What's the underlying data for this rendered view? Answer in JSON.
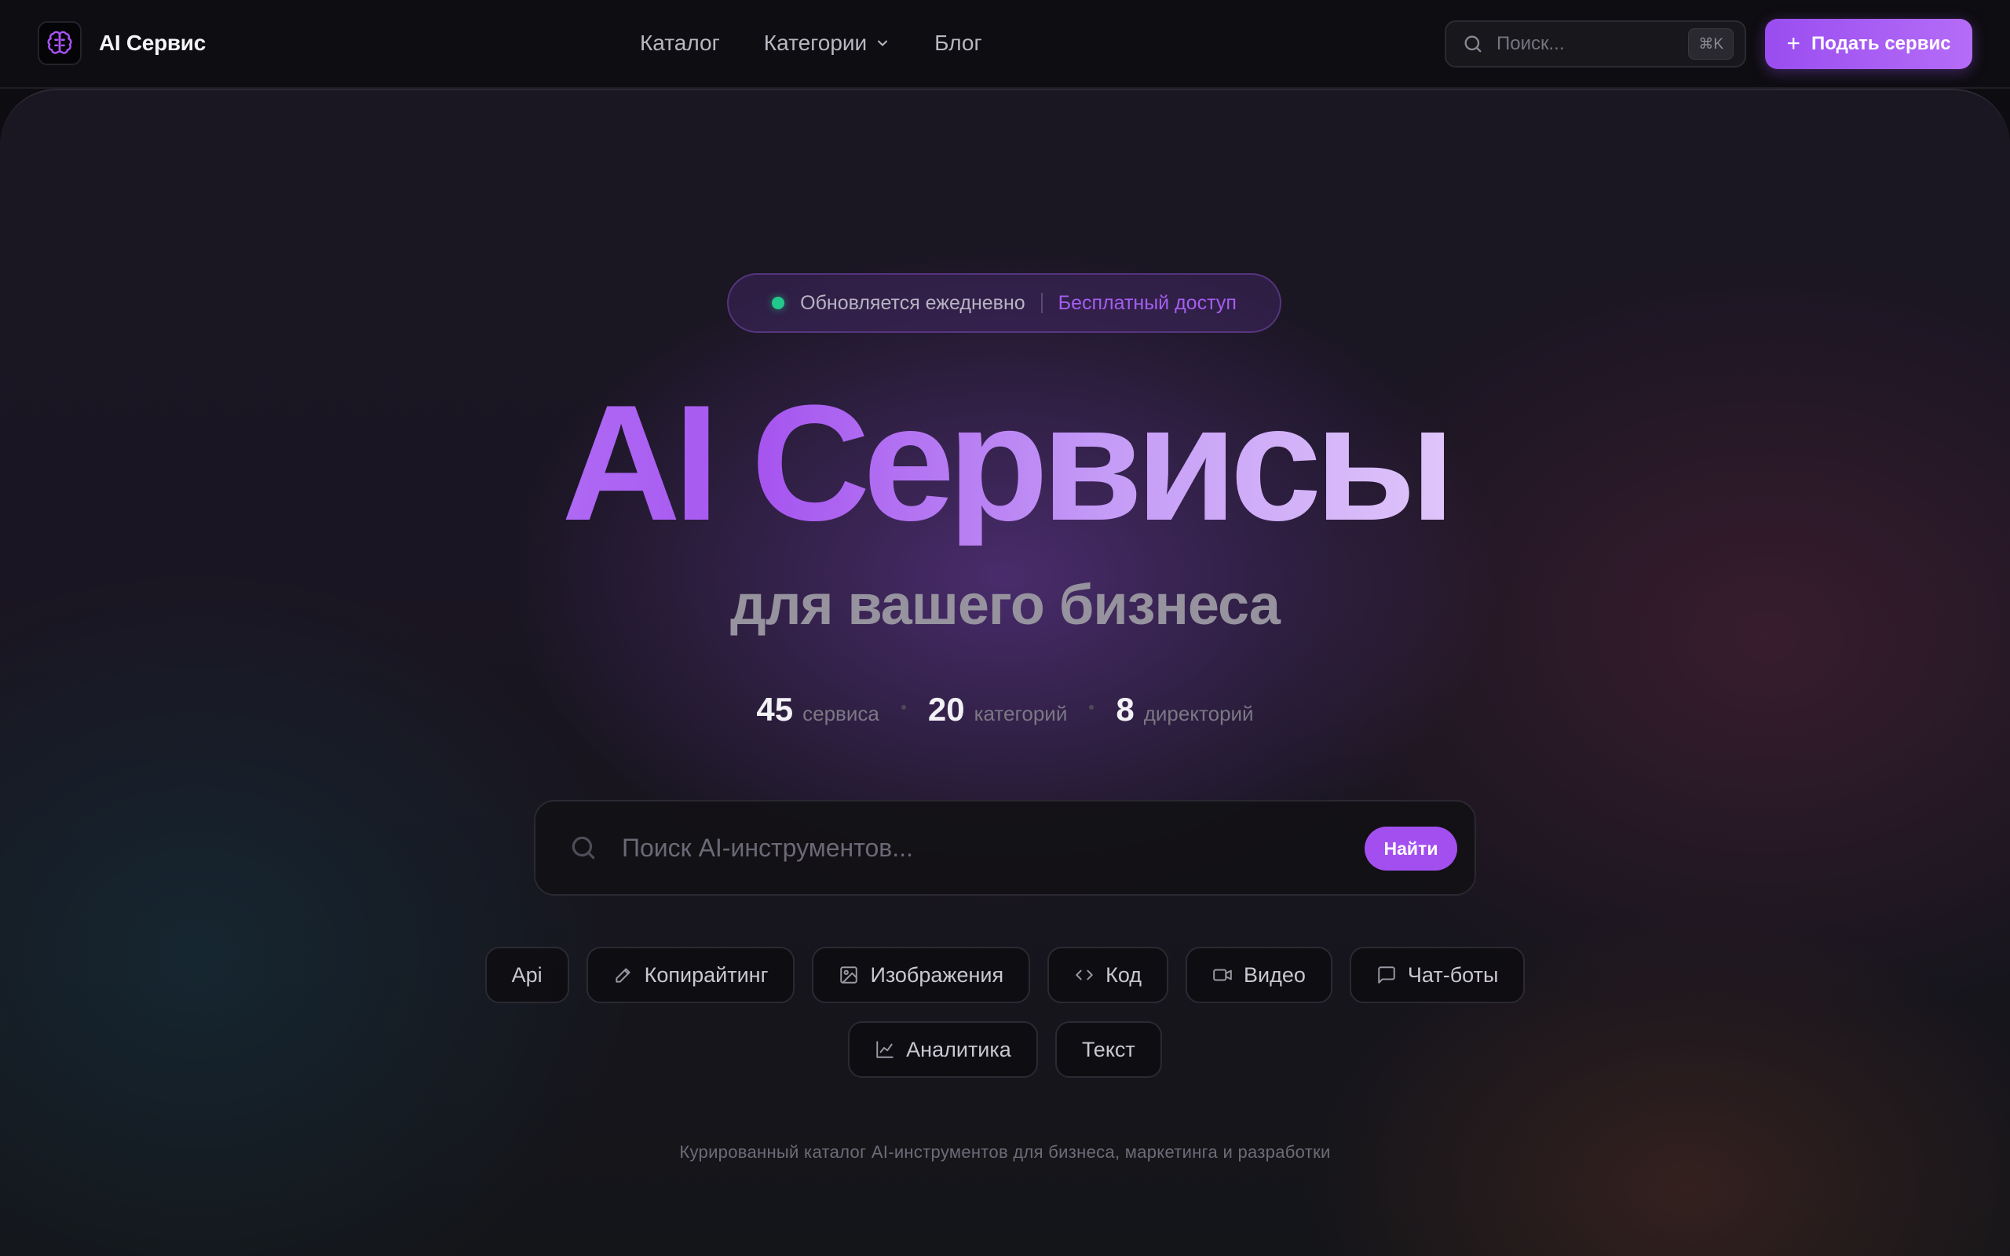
{
  "brand": {
    "name": "AI Сервис",
    "logo_icon": "brain-icon"
  },
  "nav": {
    "items": [
      {
        "label": "Каталог"
      },
      {
        "label": "Категории",
        "icon": "chevron-down-icon"
      },
      {
        "label": "Блог"
      }
    ]
  },
  "top_search": {
    "placeholder": "Поиск...",
    "shortcut": "⌘K"
  },
  "submit_button": {
    "label": "Подать сервис",
    "icon": "plus-icon"
  },
  "hero": {
    "badge": {
      "status": "Обновляется ежедневно",
      "highlight": "Бесплатный доступ",
      "status_color": "#22c98a"
    },
    "title": "AI Сервисы",
    "subtitle": "для вашего бизнеса",
    "stats": [
      {
        "value": "45",
        "label": "сервиса"
      },
      {
        "value": "20",
        "label": "категорий"
      },
      {
        "value": "8",
        "label": "директорий"
      }
    ],
    "search": {
      "placeholder": "Поиск AI-инструментов...",
      "button_label": "Найти"
    },
    "chips_row1": [
      {
        "label": "Api",
        "icon": ""
      },
      {
        "label": "Копирайтинг",
        "icon": "pencil-icon"
      },
      {
        "label": "Изображения",
        "icon": "image-icon"
      },
      {
        "label": "Код",
        "icon": "code-icon"
      },
      {
        "label": "Видео",
        "icon": "video-icon"
      },
      {
        "label": "Чат-боты",
        "icon": "chat-icon"
      }
    ],
    "chips_row2": [
      {
        "label": "Аналитика",
        "icon": "chart-icon"
      },
      {
        "label": "Текст",
        "icon": ""
      }
    ],
    "footnote": "Курированный каталог AI-инструментов для бизнеса, маркетинга и разработки"
  },
  "colors": {
    "accent": "#a34ff0",
    "accent_light": "#b56cf7",
    "background": "#0d0c10"
  }
}
